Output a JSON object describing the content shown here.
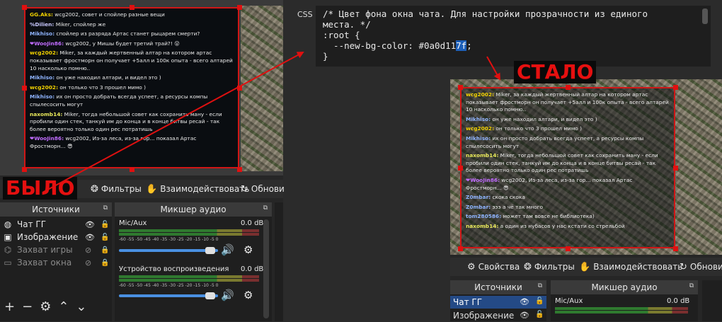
{
  "before_label": "БЫЛО",
  "after_label": "СТАЛО",
  "css_panel": {
    "label": "CSS",
    "lines": [
      "/* Цвет фона окна чата. Для настройки прозрачности из единого",
      "места. */",
      ":root {",
      "  --new-bg-color: #0a0d11"
    ],
    "selected_suffix": "7f",
    "trailing": ";",
    "last_line": "}"
  },
  "before": {
    "chat": [
      {
        "nick": "GG.Aks:",
        "color": "#f0d000",
        "text": " wcg2002, совет и спойлер разные вещи"
      },
      {
        "nick": "%Dilien:",
        "color": "#c8c8ff",
        "text": " Miker, спойлер же"
      },
      {
        "nick": "Mikhiso:",
        "color": "#8fb4ff",
        "text": " спойлер из разряда Артас станет рыцарем смерти?"
      },
      {
        "nick": "❤WooJin86:",
        "color": "#c06cff",
        "text": " wcg2002, у Мишы будет третий трай?! 😮"
      },
      {
        "nick": "wcg2002:",
        "color": "#f0d000",
        "text": " Miker, за каждый жертвенный алтар на котором артас показывает фростморн он получает +5алл и 100к опыта - всего алтарей 10 насколько помню.."
      },
      {
        "nick": "Mikhiso:",
        "color": "#8fb4ff",
        "text": " он уже находил алтари, и видел это )"
      },
      {
        "nick": "wcg2002:",
        "color": "#f0d000",
        "text": " он только что 3 прошел мимо )"
      },
      {
        "nick": "Mikhiso:",
        "color": "#8fb4ff",
        "text": " их он просто добрать всегда успеет, а ресурсы компы спылесосить могут"
      },
      {
        "nick": "naxomb14:",
        "color": "#e8e85a",
        "text": " Miker, тогда небольшой совет как сохранить ману - если пробили один стек, танкуй им до конца и в конце битвы ресай - так более вероятно только один рес потратишь"
      },
      {
        "nick": "❤WooJin86:",
        "color": "#c06cff",
        "text": " wcg2002, Из-за леса, из-за гор... показал Артас Фростморн... 😎"
      }
    ],
    "toolbar": {
      "filters": "Фильтры",
      "interact": "Взаимодействовать",
      "refresh": "Обнови",
      "properties_tail": "а"
    },
    "sources_header": "Источники",
    "sources": [
      {
        "name": "Чат ГГ",
        "icon": "globe-icon",
        "visible": true,
        "locked": false
      },
      {
        "name": "Изображение",
        "icon": "image-icon",
        "visible": true,
        "locked": false
      },
      {
        "name": "Захват игры",
        "icon": "gamepad-icon",
        "visible": false,
        "locked": true
      },
      {
        "name": "Захват окна",
        "icon": "window-icon",
        "visible": false,
        "locked": true
      }
    ],
    "mixer_header": "Микшер аудио",
    "mixer": [
      {
        "name": "Mic/Aux",
        "db": "0.0 dB"
      },
      {
        "name": "Устройство воспроизведения",
        "db": "0.0 dB"
      }
    ],
    "ticks": "-60 -55 -50 -45 -40 -35 -30 -25 -20 -15 -10 -5 0"
  },
  "after": {
    "chat": [
      {
        "nick": "wcg2002:",
        "color": "#f0d000",
        "text": " Miker, за каждый жертвенный алтар на котором артас показывает фростморн он получает +5алл и 100к опыта - всего алтарей 10 насколько помню.."
      },
      {
        "nick": "Mikhiso:",
        "color": "#8fb4ff",
        "text": " он уже находил алтари, и видел это )"
      },
      {
        "nick": "wcg2002:",
        "color": "#f0d000",
        "text": " он только что 3 прошел мимо )"
      },
      {
        "nick": "Mikhiso:",
        "color": "#8fb4ff",
        "text": " их он просто добрать всегда успеет, а ресурсы компы спылесосить могут"
      },
      {
        "nick": "naxomb14:",
        "color": "#e8e85a",
        "text": " Miker, тогда небольшой совет как сохранить ману - если пробили один стек, танкуй им до конца и в конце битвы ресай - так более вероятно только один рес потратишь"
      },
      {
        "nick": "❤WooJin86:",
        "color": "#c06cff",
        "text": " wcg2002, Из-за леса, из-за гор... показал Артас Фростморн... 😎"
      },
      {
        "nick": "Z0mbar:",
        "color": "#8fb4ff",
        "text": " скока скока"
      },
      {
        "nick": "Z0mbar:",
        "color": "#8fb4ff",
        "text": " эээ а чё так много"
      },
      {
        "nick": "tom280586:",
        "color": "#8fb4ff",
        "text": " может там вовсе не библиотека)"
      },
      {
        "nick": "naxomb14:",
        "color": "#e8e85a",
        "text": " а один из нубасов у нас кстати со стрельбой"
      }
    ],
    "toolbar": {
      "properties": "Свойства",
      "filters": "Фильтры",
      "interact": "Взаимодействовать",
      "refresh": "Обнови"
    },
    "sources_header": "Источники",
    "sources": [
      {
        "name": "Чат ГГ"
      },
      {
        "name": "Изображение"
      }
    ],
    "mixer_header": "Микшер аудио",
    "mixer": [
      {
        "name": "Mic/Aux",
        "db": "0.0 dB"
      }
    ]
  }
}
